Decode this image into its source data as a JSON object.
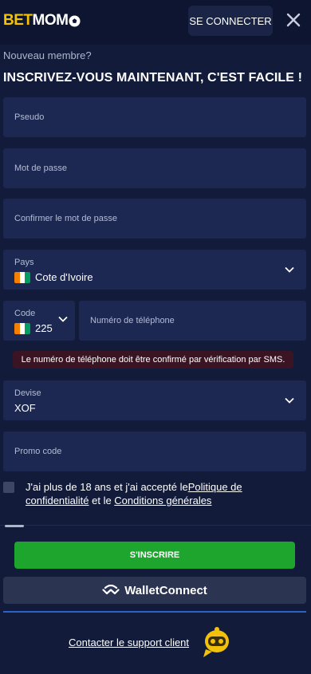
{
  "brand": {
    "part1": "BET",
    "part2": "MOM",
    "accent": "#f5c400"
  },
  "header": {
    "login_label": "SE CONNECTER"
  },
  "form": {
    "subtitle": "Nouveau membre?",
    "title": "INSCRIVEZ-VOUS MAINTENANT, C'EST FACILE !",
    "pseudo_placeholder": "Pseudo",
    "password_placeholder": "Mot de passe",
    "confirm_placeholder": "Confirmer le mot de passe",
    "country": {
      "label": "Pays",
      "value": "Cote d'Ivoire"
    },
    "code": {
      "label": "Code",
      "value": "225"
    },
    "phone_placeholder": "Numéro de téléphone",
    "sms_warning": "Le numéro de téléphone doit être confirmé par vérification par SMS.",
    "currency": {
      "label": "Devise",
      "value": "XOF"
    },
    "promo_placeholder": "Promo code",
    "terms": {
      "prefix": "J'ai plus de 18 ans et j'ai accepté le",
      "privacy_link": "Politique de confidentialité",
      "middle": " et le ",
      "conditions_link": "Conditions générales"
    },
    "signup_label": "S'INSCRIRE",
    "wallet_label": "WalletConnect"
  },
  "footer": {
    "support_label": "Contacter le support client"
  },
  "colors": {
    "primary_green": "#1ea52e",
    "panel": "#121b3a",
    "field": "#1c2752",
    "warning_bg": "#3b1424"
  }
}
